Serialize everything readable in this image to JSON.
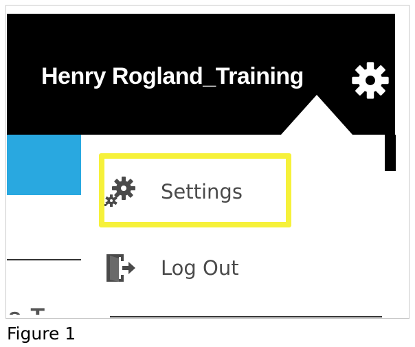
{
  "header": {
    "user_name": "Henry Rogland_Training",
    "settings_icon": "gear-icon",
    "background_color": "#000000",
    "text_color": "#ffffff"
  },
  "sidebar": {
    "active_tab_color": "#29a8e0",
    "partial_text": "s T"
  },
  "dropdown_menu": {
    "items": [
      {
        "label": "Settings",
        "icon": "gears-icon"
      },
      {
        "label": "Log Out",
        "icon": "logout-icon"
      }
    ],
    "highlighted_item": "Settings",
    "highlight_color": "#f6f13a",
    "text_color": "#4a4a4a"
  },
  "caption": "Figure 1"
}
